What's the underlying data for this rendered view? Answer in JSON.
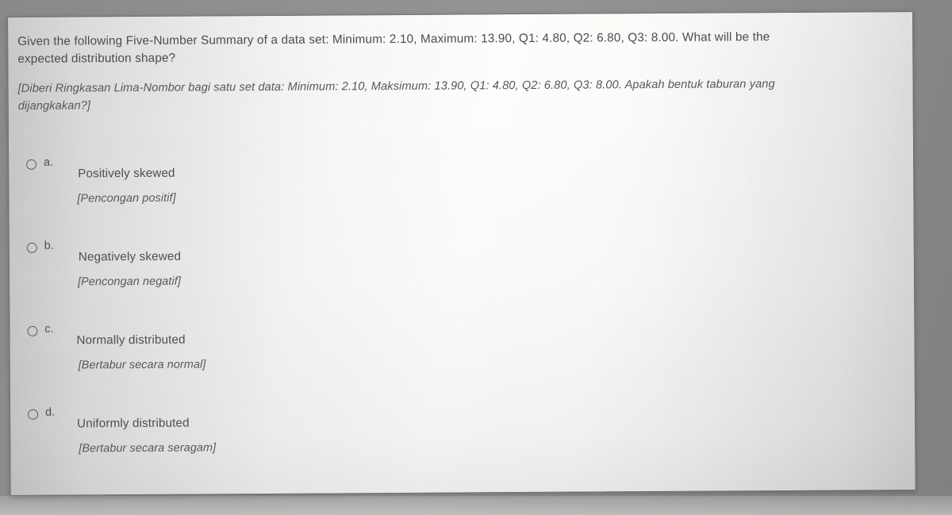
{
  "question": {
    "stem_lines": [
      "Given the following Five-Number Summary of a data set: Minimum: 2.10, Maximum: 13.90, Q1: 4.80, Q2: 6.80, Q3: 8.00. What will be the",
      "expected distribution shape?"
    ],
    "translation_lines": [
      "[Diberi Ringkasan Lima-Nombor bagi satu set data: Minimum: 2.10, Maksimum: 13.90, Q1: 4.80, Q2: 6.80, Q3: 8.00. Apakah bentuk taburan yang",
      "dijangkakan?]"
    ],
    "five_number_summary": {
      "minimum": "2.10",
      "maximum": "13.90",
      "q1": "4.80",
      "q2": "6.80",
      "q3": "8.00"
    }
  },
  "options": [
    {
      "letter": "a.",
      "label": "Positively skewed",
      "translation": "[Pencongan positif]",
      "selected": false,
      "radio_icon": "radio-unchecked-icon"
    },
    {
      "letter": "b.",
      "label": "Negatively skewed",
      "translation": "[Pencongan negatif]",
      "selected": false,
      "radio_icon": "radio-unchecked-icon"
    },
    {
      "letter": "c.",
      "label": "Normally distributed",
      "translation": "[Bertabur secara normal]",
      "selected": false,
      "radio_icon": "radio-unchecked-icon"
    },
    {
      "letter": "d.",
      "label": "Uniformly distributed",
      "translation": "[Bertabur secara seragam]",
      "selected": false,
      "radio_icon": "radio-unchecked-icon"
    }
  ],
  "colors": {
    "page_background": "#8e908d",
    "card_background": "#fdfdfd",
    "card_border": "#6f7270",
    "text_primary": "#4b4d4e",
    "text_translation": "#55585a",
    "radio_border": "#5a5d5e"
  }
}
